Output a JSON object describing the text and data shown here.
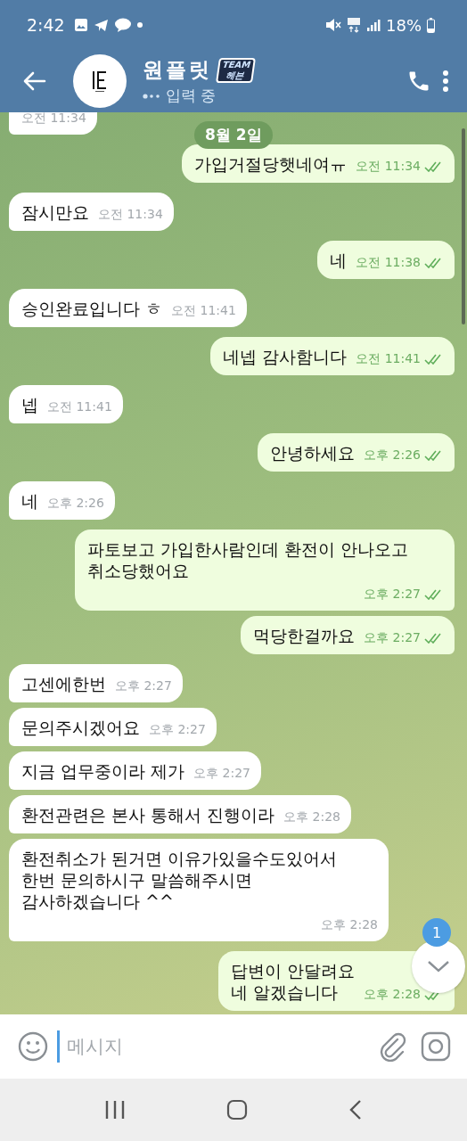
{
  "status_bar": {
    "time": "2:42",
    "battery": "18%"
  },
  "header": {
    "name": "원플릿",
    "badge": [
      "TEAM",
      "헤븐"
    ],
    "status": "입력 중"
  },
  "date_chip": "8월 2일",
  "messages": [
    {
      "kind": "in",
      "time": "오전 11:34"
    },
    {
      "kind": "out",
      "text": "가입거절당햇네여ㅠ",
      "time": "오전 11:34",
      "read": true
    },
    {
      "kind": "in",
      "text": "잠시만요",
      "time": "오전 11:34"
    },
    {
      "kind": "out",
      "text": "네",
      "time": "오전 11:38",
      "read": true
    },
    {
      "kind": "in",
      "text": "승인완료입니다 ㅎ",
      "time": "오전 11:41"
    },
    {
      "kind": "out",
      "text": "네넵 감사함니다",
      "time": "오전 11:41",
      "read": true
    },
    {
      "kind": "in",
      "text": "넵",
      "time": "오전 11:41"
    },
    {
      "kind": "out",
      "text": "안녕하세요",
      "time": "오후 2:26",
      "read": true
    },
    {
      "kind": "in",
      "text": "네",
      "time": "오후 2:26"
    },
    {
      "kind": "out",
      "text": "파토보고 가입한사람인데 환전이 안나오고\n취소당했어요",
      "time": "오후 2:27",
      "read": true
    },
    {
      "kind": "out",
      "text": "먹당한걸까요",
      "time": "오후 2:27",
      "read": true
    },
    {
      "kind": "in",
      "text": "고센에한번",
      "time": "오후 2:27"
    },
    {
      "kind": "in",
      "text": "문의주시겠어요",
      "time": "오후 2:27"
    },
    {
      "kind": "in",
      "text": "지금 업무중이라 제가",
      "time": "오후 2:27"
    },
    {
      "kind": "in",
      "text": "환전관련은 본사 통해서 진행이라",
      "time": "오후 2:28"
    },
    {
      "kind": "in",
      "text": "환전취소가 된거면 이유가있을수도있어서\n한번 문의하시구 말씀해주시면\n감사하겠습니다 ^^",
      "time": "오후 2:28"
    },
    {
      "kind": "out",
      "text": "답변이 안달려요\n네 알겠습니다",
      "time": "오후 2:28",
      "read": true
    }
  ],
  "unread_count": "1",
  "composer": {
    "placeholder": "메시지"
  }
}
